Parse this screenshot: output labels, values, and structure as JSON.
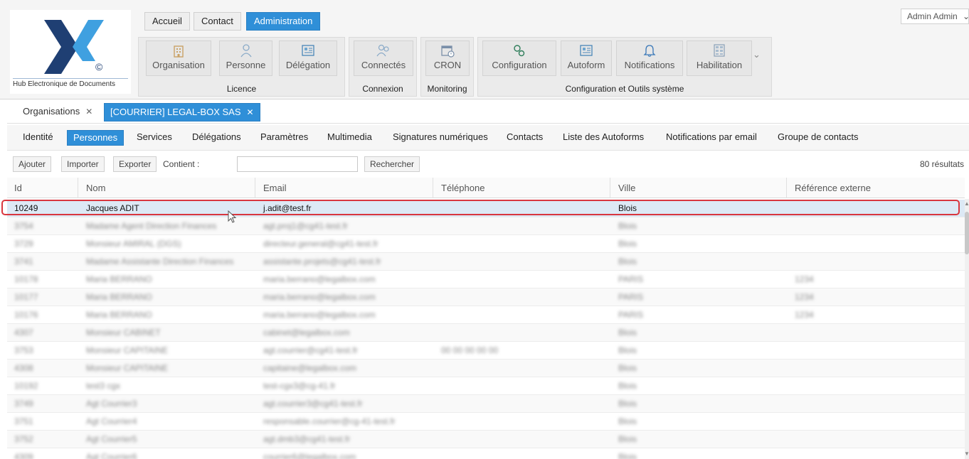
{
  "logo": {
    "caption": "Hub Electronique de Documents",
    "copyright": "©"
  },
  "user_menu": {
    "label": "Admin Admin"
  },
  "top_nav": [
    {
      "label": "Accueil",
      "active": false
    },
    {
      "label": "Contact",
      "active": false
    },
    {
      "label": "Administration",
      "active": true
    }
  ],
  "ribbon": {
    "groups": [
      {
        "label": "Licence",
        "buttons": [
          "Organisation",
          "Personne",
          "Délégation"
        ]
      },
      {
        "label": "Connexion",
        "buttons": [
          "Connectés"
        ]
      },
      {
        "label": "Monitoring",
        "buttons": [
          "CRON"
        ]
      },
      {
        "label": "Configuration et Outils système",
        "buttons": [
          "Configuration",
          "Autoform",
          "Notifications",
          "Habilitation"
        ]
      }
    ]
  },
  "doc_tabs": [
    {
      "label": "Organisations",
      "active": false
    },
    {
      "label": "[COURRIER] LEGAL-BOX SAS",
      "active": true
    }
  ],
  "sub_tabs": [
    "Identité",
    "Personnes",
    "Services",
    "Délégations",
    "Paramètres",
    "Multimedia",
    "Signatures numériques",
    "Contacts",
    "Liste des Autoforms",
    "Notifications par email",
    "Groupe de contacts"
  ],
  "active_sub_tab": "Personnes",
  "toolbar": {
    "add": "Ajouter",
    "import": "Importer",
    "export": "Exporter",
    "contains_label": "Contient :",
    "search_value": "",
    "search_button": "Rechercher",
    "results": "80 résultats"
  },
  "table": {
    "columns": [
      "Id",
      "Nom",
      "Email",
      "Téléphone",
      "Ville",
      "Référence externe"
    ],
    "rows": [
      [
        "10249",
        "Jacques ADIT",
        "j.adit@test.fr",
        "",
        "Blois",
        ""
      ],
      [
        "3754",
        "Madame Agent Direction Finances",
        "agt.proj1@cg41-test.fr",
        "",
        "Blois",
        ""
      ],
      [
        "3729",
        "Monsieur AMIRAL (DGS)",
        "directeur.general@cg41-test.fr",
        "",
        "Blois",
        ""
      ],
      [
        "3741",
        "Madame Assistante Direction Finances",
        "assistante.projets@cg41-test.fr",
        "",
        "Blois",
        ""
      ],
      [
        "10178",
        "Maria BERRANO",
        "maria.berrano@legalbox.com",
        "",
        "PARIS",
        "1234"
      ],
      [
        "10177",
        "Maria BERRANO",
        "maria.berrano@legalbox.com",
        "",
        "PARIS",
        "1234"
      ],
      [
        "10176",
        "Maria BERRANO",
        "maria.berrano@legalbox.com",
        "",
        "PARIS",
        "1234"
      ],
      [
        "4307",
        "Monsieur CABINET",
        "cabinet@legalbox.com",
        "",
        "Blois",
        ""
      ],
      [
        "3753",
        "Monsieur CAPITAINE",
        "agt.courrier@cg41-test.fr",
        "00 00 00 00 00",
        "Blois",
        ""
      ],
      [
        "4308",
        "Monsieur CAPITAINE",
        "capitaine@legalbox.com",
        "",
        "Blois",
        ""
      ],
      [
        "10192",
        "test3 cgx",
        "test-cgx3@cg-41.fr",
        "",
        "Blois",
        ""
      ],
      [
        "3749",
        "Agt Courrier3",
        "agt.courrier3@cg41-test.fr",
        "",
        "Blois",
        ""
      ],
      [
        "3751",
        "Agt Courrier4",
        "responsable.courrier@cg-41-test.fr",
        "",
        "Blois",
        ""
      ],
      [
        "3752",
        "Agt Courrier5",
        "agt.dmb3@cg41-test.fr",
        "",
        "Blois",
        ""
      ],
      [
        "4309",
        "Agt Courrier6",
        "courrier6@legalbox.com",
        "",
        "Blois",
        ""
      ]
    ]
  },
  "colors": {
    "accent": "#2f8fd8",
    "highlight": "#d9363e",
    "logo_dark": "#1f3f73",
    "logo_light": "#3fa0e0"
  }
}
